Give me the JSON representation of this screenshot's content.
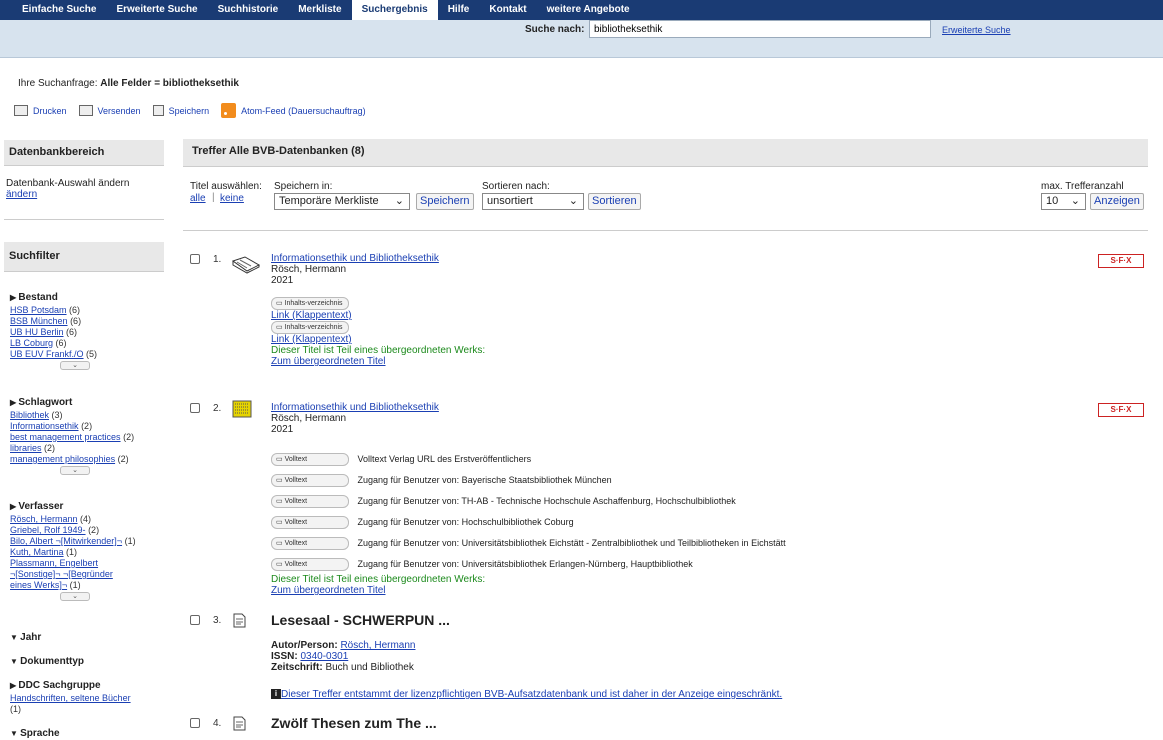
{
  "nav": {
    "tabs": [
      "Einfache Suche",
      "Erweiterte Suche",
      "Suchhistorie",
      "Merkliste",
      "Suchergebnis",
      "Hilfe",
      "Kontakt",
      "weitere Angebote"
    ],
    "active": 4
  },
  "search": {
    "label": "Suche nach:",
    "value": "bibliotheksethik",
    "advanced": "Erweiterte Suche"
  },
  "query": {
    "prefix": "Ihre Suchanfrage:",
    "value": "Alle Felder = bibliotheksethik"
  },
  "actions": {
    "print": "Drucken",
    "send": "Versenden",
    "save": "Speichern",
    "feed": "Atom-Feed (Dauersuchauftrag)"
  },
  "left": {
    "db_head": "Datenbankbereich",
    "db_text": "Datenbank-Auswahl ändern",
    "db_link": "ändern",
    "filter_head": "Suchfilter",
    "groups": {
      "bestand": {
        "title": "Bestand",
        "items": [
          {
            "l": "HSB Potsdam",
            "c": "(6)"
          },
          {
            "l": "BSB München",
            "c": "(6)"
          },
          {
            "l": "UB HU Berlin",
            "c": "(6)"
          },
          {
            "l": "LB Coburg",
            "c": "(6)"
          },
          {
            "l": "UB EUV Frankf./O",
            "c": "(5)"
          }
        ]
      },
      "schlagwort": {
        "title": "Schlagwort",
        "items": [
          {
            "l": "Bibliothek",
            "c": "(3)"
          },
          {
            "l": "Informationsethik",
            "c": "(2)"
          },
          {
            "l": "best management practices",
            "c": "(2)"
          },
          {
            "l": "libraries",
            "c": "(2)"
          },
          {
            "l": "management philosophies",
            "c": "(2)"
          }
        ]
      },
      "verfasser": {
        "title": "Verfasser",
        "items": [
          {
            "l": "Rösch, Hermann",
            "c": "(4)"
          },
          {
            "l": "Griebel, Rolf 1949-",
            "c": "(2)"
          },
          {
            "l": "Bilo, Albert ¬[Mitwirkender]¬",
            "c": "(1)"
          },
          {
            "l": "Kuth, Martina",
            "c": "(1)"
          },
          {
            "l": "Plassmann, Engelbert ¬[Sonstige]¬ ¬[Begründer eines Werks]¬",
            "c": "(1)"
          }
        ]
      },
      "jahr": {
        "title": "Jahr"
      },
      "dokumenttyp": {
        "title": "Dokumenttyp"
      },
      "ddc": {
        "title": "DDC Sachgruppe",
        "items": [
          {
            "l": "Handschriften, seltene Bücher",
            "c": "(1)"
          }
        ]
      },
      "sprache": {
        "title": "Sprache"
      }
    }
  },
  "results": {
    "head": "Treffer Alle BVB-Datenbanken (8)",
    "select_label": "Titel auswählen:",
    "all": "alle",
    "none": "keine",
    "save_in": "Speichern in:",
    "save_sel": "Temporäre Merkliste",
    "save_btn": "Speichern",
    "sort_label": "Sortieren nach:",
    "sort_sel": "unsortiert",
    "sort_btn": "Sortieren",
    "max_label": "max. Trefferanzahl",
    "max_sel": "10",
    "show_btn": "Anzeigen",
    "sfx": "S·F·X",
    "inhalt": "Inhalts-verzeichnis",
    "volltext": "Volltext",
    "r1": {
      "num": "1.",
      "title": "Informationsethik und Bibliotheksethik",
      "author": "Rösch, Hermann",
      "year": "2021",
      "link": "Link (Klappentext)",
      "part": "Dieser Titel ist Teil eines übergeordneten Werks:",
      "up": "Zum übergeordneten Titel"
    },
    "r2": {
      "num": "2.",
      "title": "Informationsethik und Bibliotheksethik",
      "author": "Rösch, Hermann",
      "year": "2021",
      "access": [
        "Volltext Verlag URL des Erstveröffentlichers",
        "Zugang für Benutzer von: Bayerische Staatsbibliothek München",
        "Zugang für Benutzer von: TH-AB - Technische Hochschule Aschaffenburg, Hochschulbibliothek",
        "Zugang für Benutzer von: Hochschulbibliothek Coburg",
        "Zugang für Benutzer von: Universitätsbibliothek Eichstätt - Zentralbibliothek und Teilbibliotheken in Eichstätt",
        "Zugang für Benutzer von: Universitätsbibliothek Erlangen-Nürnberg, Hauptbibliothek"
      ],
      "part": "Dieser Titel ist Teil eines übergeordneten Werks:",
      "up": "Zum übergeordneten Titel"
    },
    "r3": {
      "num": "3.",
      "title": "Lesesaal - SCHWERPUN ...",
      "author_lbl": "Autor/Person:",
      "author": "Rösch, Hermann",
      "issn_lbl": "ISSN:",
      "issn": "0340-0301",
      "zs_lbl": "Zeitschrift:",
      "zs": "Buch und Bibliothek",
      "notice": "Dieser Treffer entstammt der lizenzpflichtigen BVB-Aufsatzdatenbank und ist daher in der Anzeige eingeschränkt."
    },
    "r4": {
      "num": "4.",
      "title": "Zwölf Thesen zum The ..."
    }
  }
}
